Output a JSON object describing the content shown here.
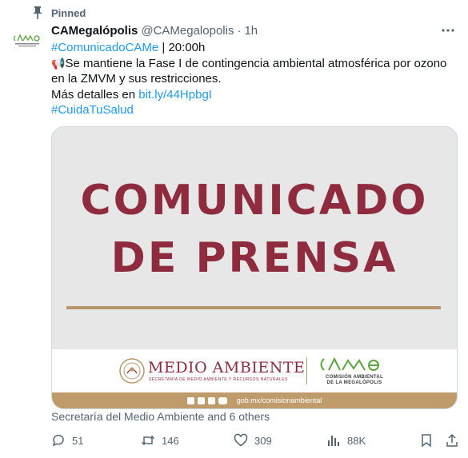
{
  "pinned_label": "Pinned",
  "author": {
    "display_name": "CAMegalópolis",
    "handle": "@CAMegalopolis",
    "separator": "·",
    "time": "1h"
  },
  "tweet": {
    "hashtag1": "#ComunicadoCAMe",
    "time_text": " | 20:00h",
    "emoji": "📢",
    "body": "Se mantiene la Fase I de contingencia ambiental atmosférica por ozono en la ZMVM y sus restricciones.",
    "details_prefix": "Más detalles en ",
    "link": "bit.ly/44HpbgI",
    "hashtag2": "#CuidaTuSalud"
  },
  "card": {
    "title_line1": "COMUNICADO",
    "title_line2": "DE PRENSA",
    "logo_title": "MEDIO AMBIENTE",
    "logo_subtitle": "SECRETARÍA DE MEDIO AMBIENTE Y RECURSOS NATURALES",
    "came_line1": "COMISIÓN AMBIENTAL",
    "came_line2": "DE LA MEGALÓPOLIS",
    "footer_url": "gob.mx/comisionambiental",
    "colors": {
      "maroon": "#8e2b3e",
      "gold": "#b8976a",
      "came_green": "#5aa63c"
    }
  },
  "social_context": "Secretaría del Medio Ambiente and 6 others",
  "actions": {
    "replies": "51",
    "reposts": "146",
    "likes": "309",
    "views": "88K"
  },
  "icons": [
    "pin-icon",
    "more-icon",
    "reply-icon",
    "repost-icon",
    "like-icon",
    "views-icon",
    "bookmark-icon",
    "share-icon"
  ]
}
